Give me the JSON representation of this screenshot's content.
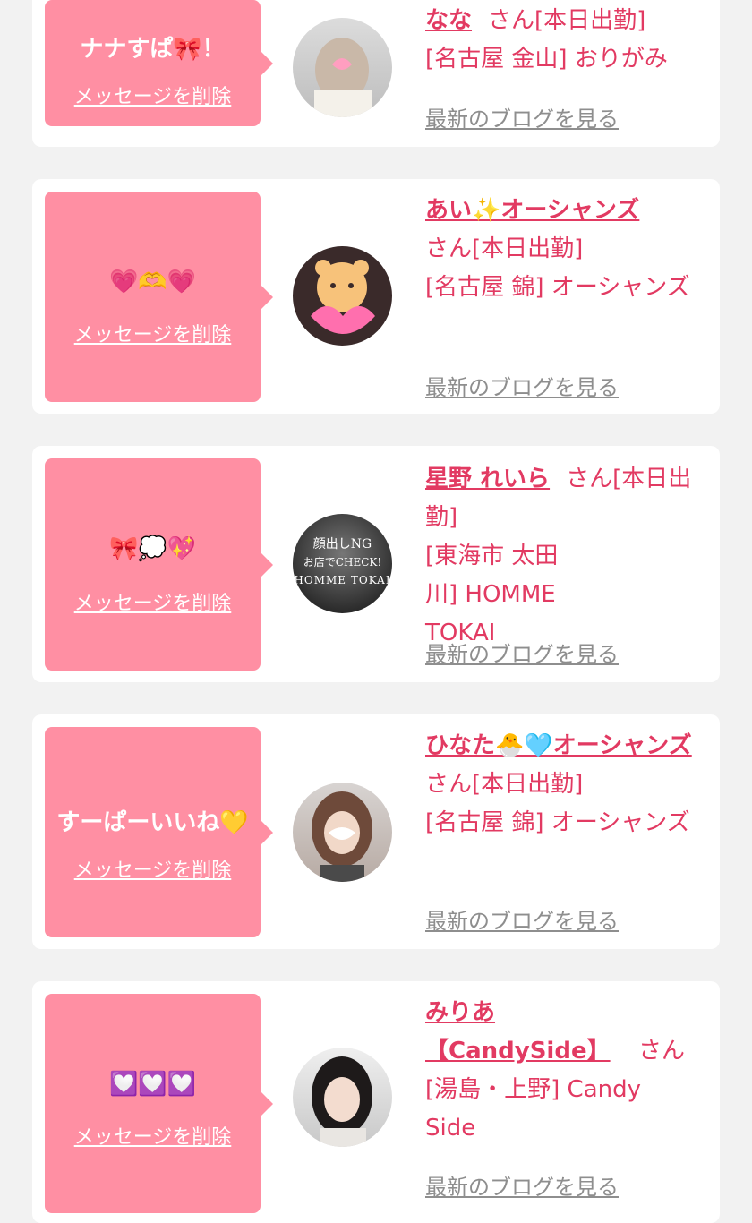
{
  "delete_label": "メッセージを削除",
  "blog_label": "最新のブログを見る",
  "san": "さん",
  "cards": [
    {
      "message": "ナナすぱ🎀！",
      "name": "なな",
      "status": "[本日出勤]",
      "location": "[名古屋 金山] おりがみ",
      "avatar": "girl-face-masked-heart"
    },
    {
      "message": "💗🫶💗",
      "name": "あい✨オーシャンズ",
      "status": "[本日出勤]",
      "location": "[名古屋 錦] オーシャンズ",
      "avatar": "bear-holding-heart"
    },
    {
      "message": "🎀💭💖",
      "name": "星野 れいら",
      "status": "[本日出勤]",
      "location": "[東海市 太田川] HOMME TOKAI",
      "avatar_text_1": "顔出しNG",
      "avatar_text_2": "お店でCHECK!",
      "avatar_text_3": "HOMME TOKAI"
    },
    {
      "message": "すーぱーいいね💛",
      "name": "ひなた🐣🩵オーシャンズ",
      "status": "[本日出勤]",
      "location": "[名古屋 錦] オーシャンズ",
      "avatar": "girl-face-masked"
    },
    {
      "message": "💟💟💟",
      "name": "みりあ【CandySide】",
      "status": "",
      "location": "[湯島・上野] Candy Side",
      "avatar": "girl-photo"
    }
  ],
  "colors": {
    "page_bg": "#f2f2f2",
    "card_bg": "#ffffff",
    "bubble": "#ff8fa3",
    "accent": "#e23a62",
    "link_gray": "#8e8e8e"
  }
}
